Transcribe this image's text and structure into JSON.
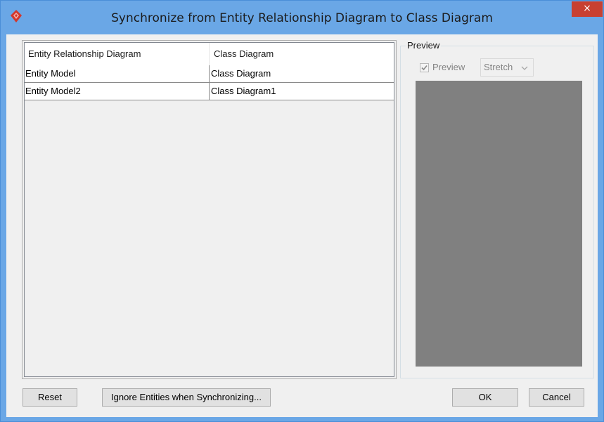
{
  "window": {
    "title": "Synchronize from Entity Relationship Diagram to Class Diagram",
    "close_glyph": "×",
    "icon": "app-logo-icon",
    "accent": "#6aa7e6",
    "close_color": "#c84031"
  },
  "table": {
    "columns": [
      "Entity Relationship Diagram",
      "Class Diagram"
    ],
    "rows": [
      [
        "Entity Model",
        "Class Diagram"
      ],
      [
        "Entity Model2",
        "Class Diagram1"
      ]
    ]
  },
  "preview": {
    "group_label": "Preview",
    "checkbox_label": "Preview",
    "checkbox_checked": true,
    "mode_value": "Stretch",
    "canvas_color": "#808080"
  },
  "buttons": {
    "reset": "Reset",
    "ignore": "Ignore Entities when Synchronizing...",
    "ok": "OK",
    "cancel": "Cancel"
  }
}
